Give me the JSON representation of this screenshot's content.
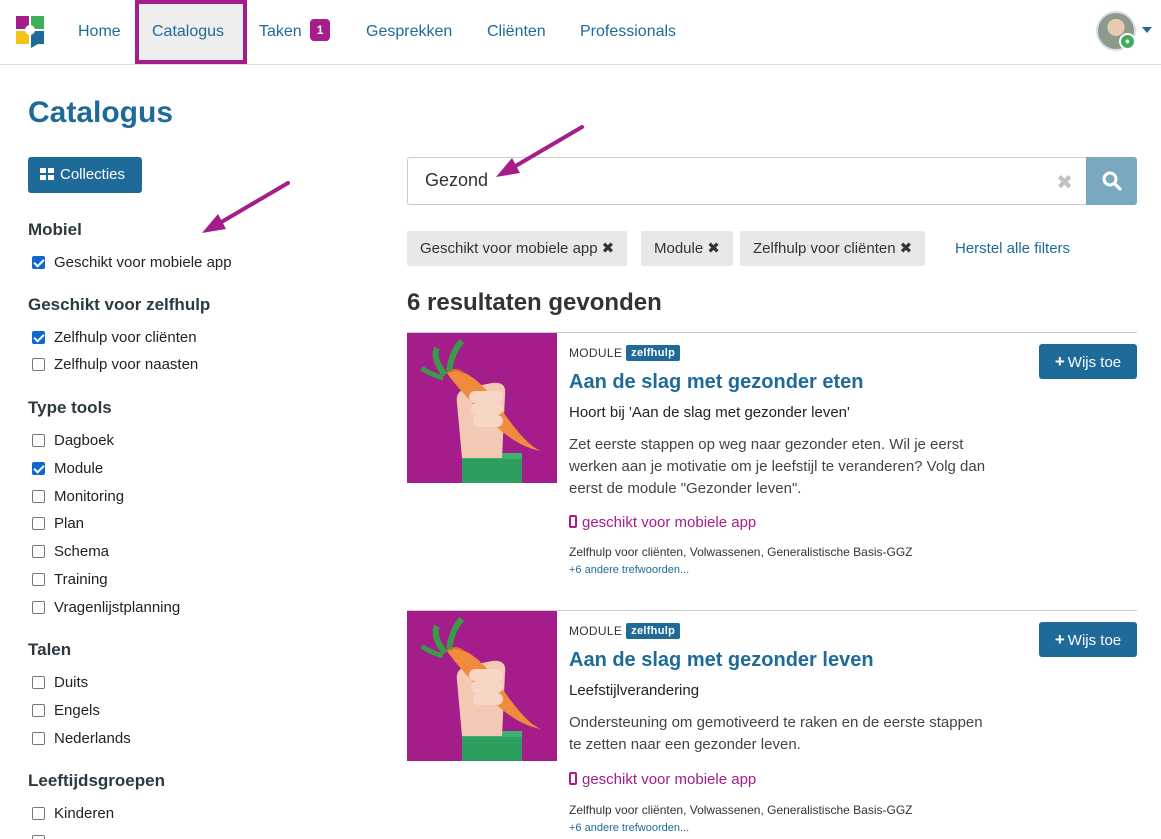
{
  "nav": {
    "items": [
      {
        "label": "Home"
      },
      {
        "label": "Catalogus"
      },
      {
        "label": "Taken",
        "badge": "1"
      },
      {
        "label": "Gesprekken"
      },
      {
        "label": "Cliënten"
      },
      {
        "label": "Professionals"
      }
    ]
  },
  "page": {
    "title": "Catalogus"
  },
  "sidebar": {
    "collections_label": "Collecties",
    "groups": [
      {
        "heading": "Mobiel",
        "options": [
          {
            "label": "Geschikt voor mobiele app",
            "checked": true
          }
        ]
      },
      {
        "heading": "Geschikt voor zelfhulp",
        "options": [
          {
            "label": "Zelfhulp voor cliënten",
            "checked": true
          },
          {
            "label": "Zelfhulp voor naasten",
            "checked": false
          }
        ]
      },
      {
        "heading": "Type tools",
        "options": [
          {
            "label": "Dagboek",
            "checked": false
          },
          {
            "label": "Module",
            "checked": true
          },
          {
            "label": "Monitoring",
            "checked": false
          },
          {
            "label": "Plan",
            "checked": false
          },
          {
            "label": "Schema",
            "checked": false
          },
          {
            "label": "Training",
            "checked": false
          },
          {
            "label": "Vragenlijstplanning",
            "checked": false
          }
        ]
      },
      {
        "heading": "Talen",
        "options": [
          {
            "label": "Duits",
            "checked": false
          },
          {
            "label": "Engels",
            "checked": false
          },
          {
            "label": "Nederlands",
            "checked": false
          }
        ]
      },
      {
        "heading": "Leeftijdsgroepen",
        "options": [
          {
            "label": "Kinderen",
            "checked": false
          }
        ]
      }
    ]
  },
  "search": {
    "value": "Gezond",
    "clear": "✖"
  },
  "filters": {
    "chips": [
      {
        "label": "Geschikt voor mobiele app"
      },
      {
        "label": "Module"
      },
      {
        "label": "Zelfhulp voor cliënten"
      }
    ],
    "chip_remove": "✖",
    "reset_label": "Herstel alle filters"
  },
  "results": {
    "count_label": "6 resultaten gevonden",
    "items": [
      {
        "type": "MODULE",
        "tag": "zelfhulp",
        "title": "Aan de slag met gezonder eten",
        "subtitle": "Hoort bij 'Aan de slag met gezonder leven'",
        "description": "Zet eerste stappen op weg naar gezonder eten. Wil je eerst werken aan je motivatie om je leefstijl te veranderen? Volg dan eerst de module \"Gezonder leven\".",
        "mobile": "geschikt voor mobiele app",
        "keywords": "Zelfhulp voor cliënten, Volwassenen, Generalistische Basis-GGZ",
        "more": "+6 andere trefwoorden...",
        "add_label": "Wijs toe"
      },
      {
        "type": "MODULE",
        "tag": "zelfhulp",
        "title": "Aan de slag met gezonder leven",
        "subtitle": "Leefstijlverandering",
        "description": "Ondersteuning om gemotiveerd te raken en de eerste stappen te zetten naar een gezonder leven.",
        "mobile": "geschikt voor mobiele app",
        "keywords": "Zelfhulp voor cliënten, Volwassenen, Generalistische Basis-GGZ",
        "more": "+6 andere trefwoorden...",
        "add_label": "Wijs toe"
      }
    ]
  },
  "colors": {
    "brand": "#1e6a99",
    "accent": "#a41d8a",
    "annotation": "#a41d8a"
  },
  "icons": [
    "logo-icon",
    "grid-icon",
    "search-icon",
    "phone-icon",
    "plus-icon",
    "eye-icon",
    "chevron-down-icon"
  ]
}
